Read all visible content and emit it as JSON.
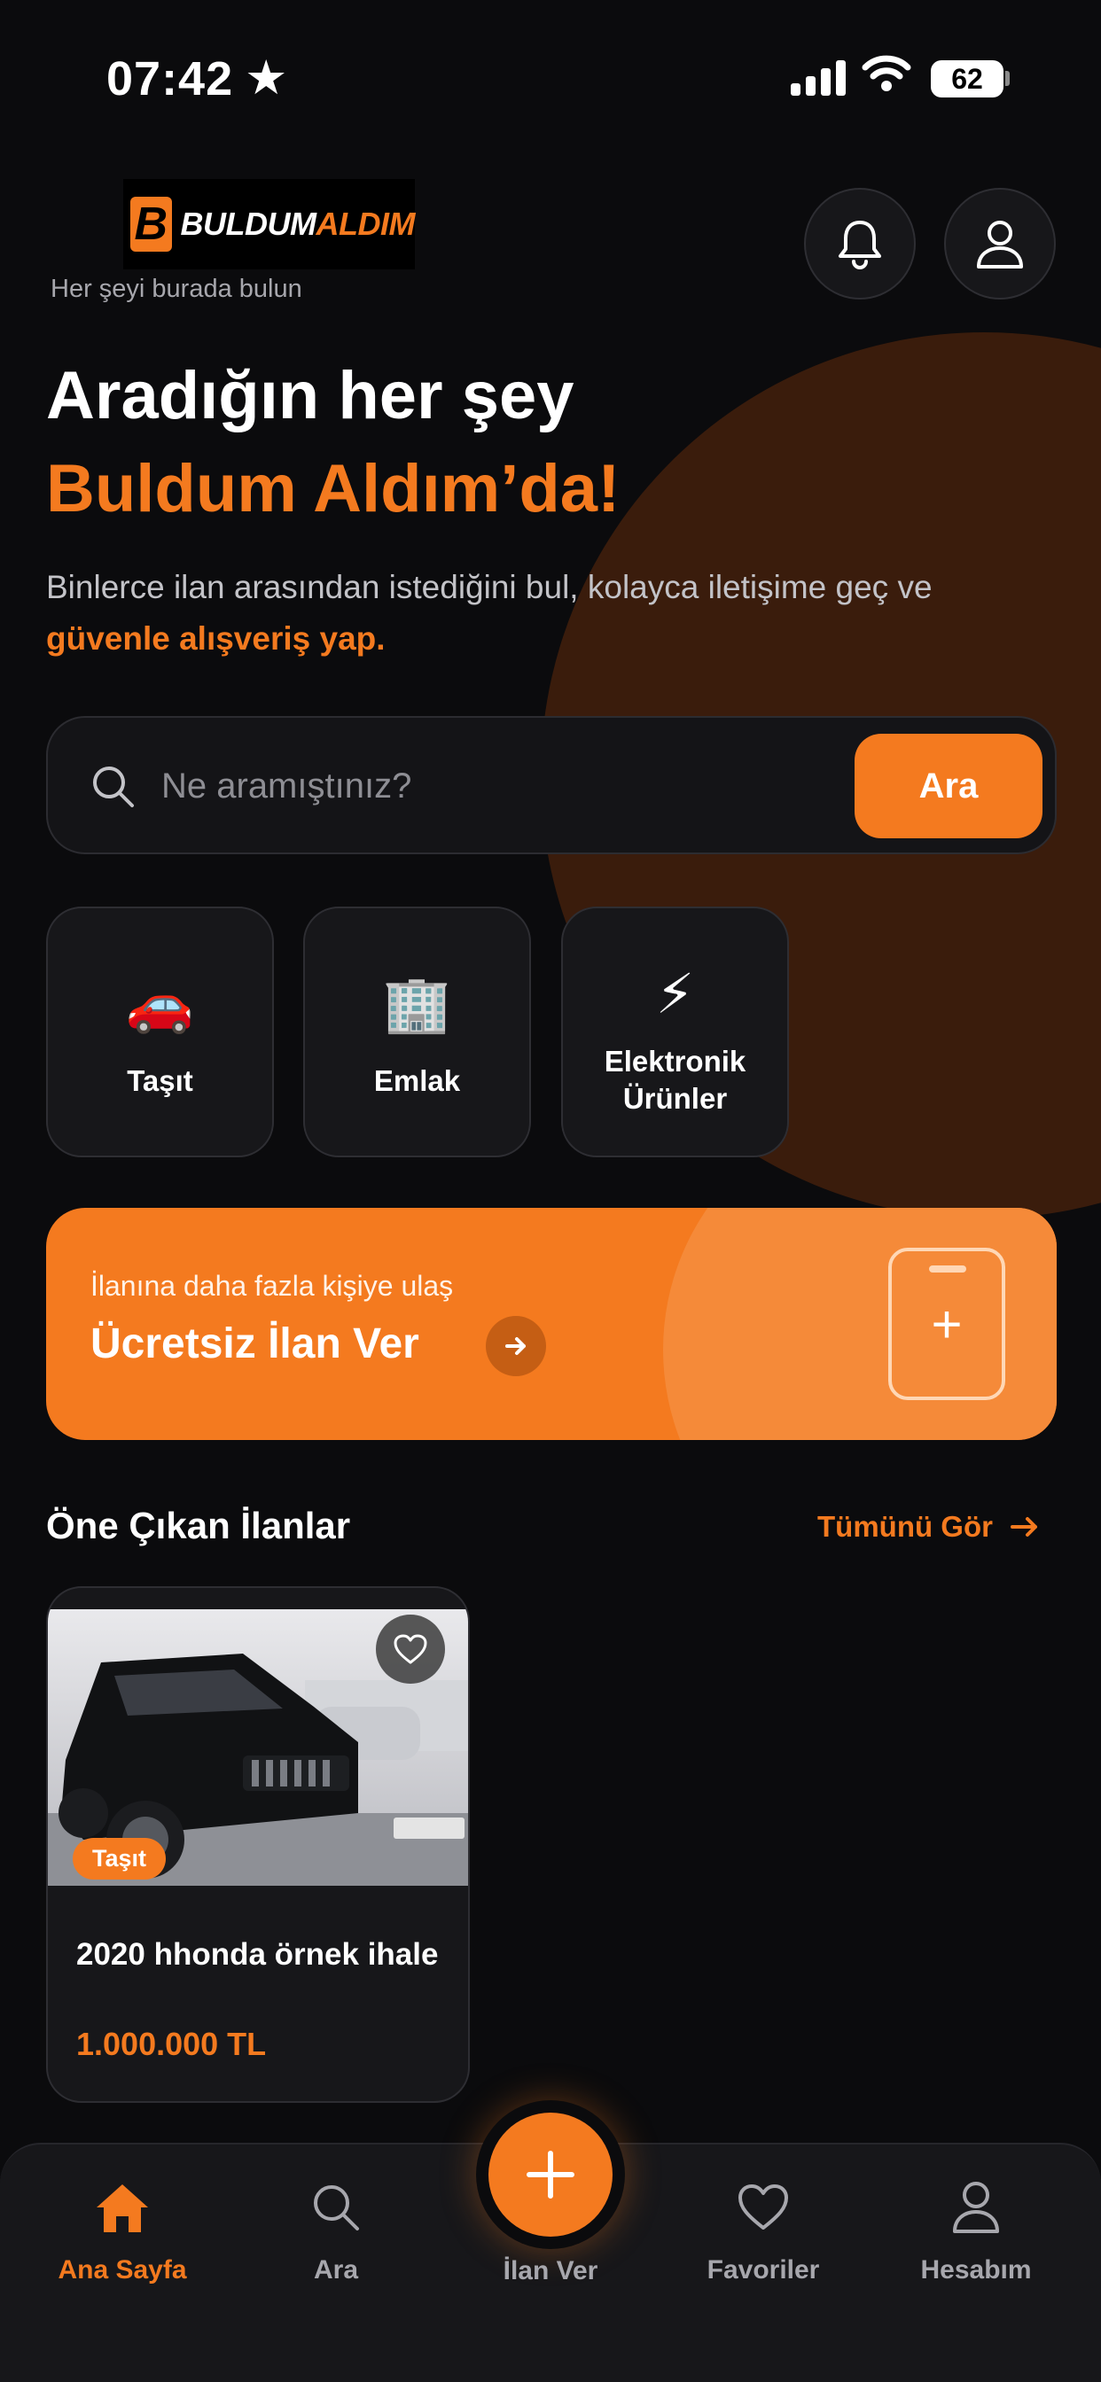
{
  "status_bar": {
    "time": "07:42",
    "star": "★",
    "battery": "62"
  },
  "header": {
    "logo_mark": "B",
    "logo_word1": "BULDUM",
    "logo_word2": "ALDIM",
    "tagline": "Her şeyi burada bulun"
  },
  "hero": {
    "line1": "Aradığın her şey",
    "line2": "Buldum Aldım’da!",
    "subtitle": "Binlerce ilan arasından istediğini bul, kolayca iletişime geç ve",
    "subtitle_highlight": "güvenle alışveriş yap."
  },
  "search": {
    "placeholder": "Ne aramıştınız?",
    "value": "",
    "button": "Ara"
  },
  "categories": [
    {
      "emoji": "🚗",
      "label": "Taşıt"
    },
    {
      "emoji": "🏢",
      "label": "Emlak"
    },
    {
      "emoji": "⚡",
      "label_line1": "Elektronik",
      "label_line2": "Ürünler"
    }
  ],
  "banner": {
    "small": "İlanına daha fazla kişiye ulaş",
    "title": "Ücretsiz İlan Ver"
  },
  "featured": {
    "title": "Öne Çıkan İlanlar",
    "see_all": "Tümünü Gör",
    "listings": [
      {
        "badge": "Taşıt",
        "title": "2020 hhonda örnek ihale",
        "price": "1.000.000 TL"
      }
    ]
  },
  "tabbar": {
    "items": [
      {
        "label": "Ana Sayfa",
        "icon": "home-icon"
      },
      {
        "label": "Ara",
        "icon": "search-icon"
      },
      {
        "label": "İlan Ver",
        "icon": "plus-icon"
      },
      {
        "label": "Favoriler",
        "icon": "heart-icon"
      },
      {
        "label": "Hesabım",
        "icon": "user-icon"
      }
    ]
  },
  "colors": {
    "accent": "#f47a1f",
    "background": "#0b0b0d",
    "card": "#17171a"
  }
}
